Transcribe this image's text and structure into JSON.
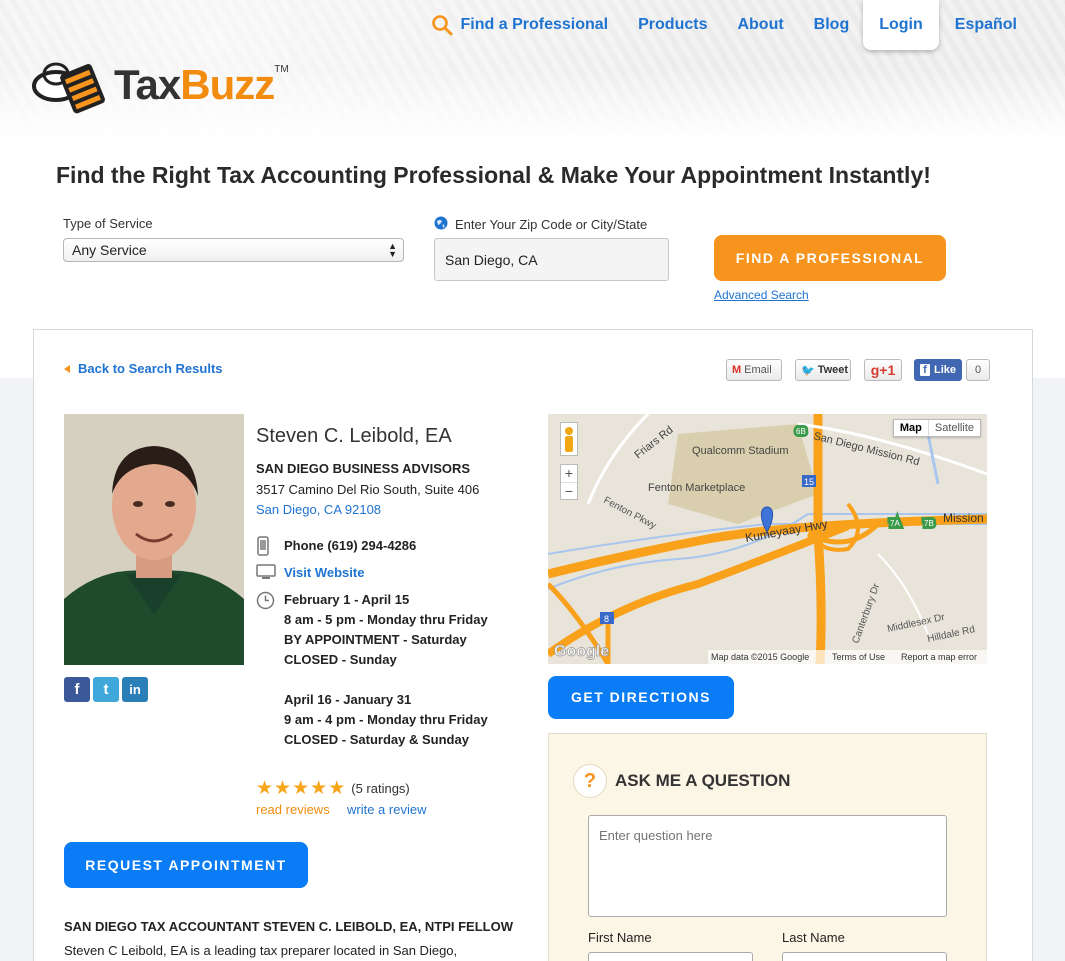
{
  "nav": {
    "find_professional": "Find a Professional",
    "products": "Products",
    "about": "About",
    "blog": "Blog",
    "login": "Login",
    "espanol": "Español"
  },
  "logo": {
    "tax": "Tax",
    "buzz": "Buzz",
    "tm": "TM"
  },
  "headline": "Find the Right Tax Accounting Professional & Make Your Appointment Instantly!",
  "search": {
    "service_label": "Type of Service",
    "service_value": "Any Service",
    "zip_label": "Enter Your Zip Code or City/State",
    "zip_value": "San Diego, CA",
    "find_button": "FIND A PROFESSIONAL",
    "advanced": "Advanced Search"
  },
  "profile": {
    "back": "Back to Search Results",
    "share": {
      "email": "Email",
      "tweet": "Tweet",
      "gplus": "g+1",
      "like": "Like",
      "like_count": "0"
    },
    "name": "Steven C. Leibold, EA",
    "company": "SAN DIEGO BUSINESS ADVISORS",
    "address1": "3517 Camino Del Rio South, Suite 406",
    "address2": "San Diego, CA 92108",
    "phone": "Phone (619) 294-4286",
    "website": "Visit Website",
    "hours": [
      "February 1 - April 15",
      "8 am - 5 pm - Monday thru Friday",
      "BY APPOINTMENT - Saturday",
      "CLOSED - Sunday",
      "April 16 - January 31",
      "9 am - 4 pm - Monday thru Friday",
      "CLOSED - Saturday & Sunday"
    ],
    "rating": 5,
    "ratings_text": "(5 ratings)",
    "read_reviews": "read reviews",
    "write_review": "write a review",
    "request_button": "REQUEST APPOINTMENT",
    "about_heading": "SAN DIEGO TAX ACCOUNTANT STEVEN C. LEIBOLD, EA, NTPI FELLOW",
    "about_text": "Steven C Leibold, EA is a leading tax preparer located in San Diego,"
  },
  "map": {
    "map_btn": "Map",
    "satellite_btn": "Satellite",
    "zoom_in": "+",
    "zoom_out": "−",
    "labels": {
      "stadium": "Qualcomm Stadium",
      "mission_rd": "San Diego Mission Rd",
      "friars": "Friars Rd",
      "fenton_mp": "Fenton Marketplace",
      "fenton_pkwy": "Fenton Pkwy",
      "hwy": "Kumeyaay Hwy",
      "mission": "Mission",
      "middlesex": "Middlesex Dr",
      "hilldale": "Hilldale Rd",
      "canterbury": "Canterbury Dr",
      "s15": "15",
      "s8": "8",
      "s6b": "6B",
      "s7a": "7A",
      "s7b": "7B"
    },
    "google": "Google",
    "attribution": "Map data ©2015 Google",
    "terms": "Terms of Use",
    "report": "Report a map error",
    "directions": "GET DIRECTIONS"
  },
  "ask": {
    "icon": "?",
    "title": "ASK ME A QUESTION",
    "placeholder": "Enter question here",
    "first_name": "First Name",
    "last_name": "Last Name"
  },
  "social": {
    "facebook": "f",
    "twitter": "t",
    "linkedin": "in"
  }
}
